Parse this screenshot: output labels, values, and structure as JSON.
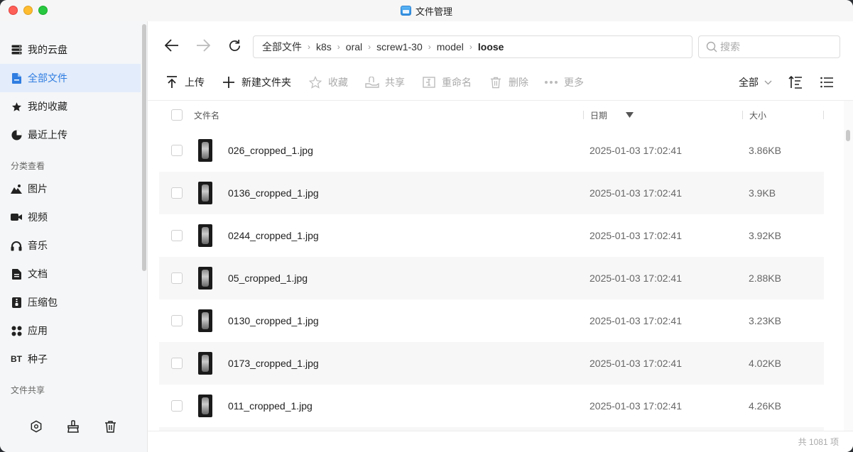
{
  "window": {
    "title": "文件管理"
  },
  "sidebar": {
    "items": [
      {
        "label": "我的云盘",
        "icon": "storage-icon",
        "active": false
      },
      {
        "label": "全部文件",
        "icon": "file-icon",
        "active": true
      },
      {
        "label": "我的收藏",
        "icon": "star-icon",
        "active": false
      },
      {
        "label": "最近上传",
        "icon": "pie-clock-icon",
        "active": false
      }
    ],
    "category_label": "分类查看",
    "categories": [
      {
        "label": "图片",
        "icon": "mountain-icon"
      },
      {
        "label": "视频",
        "icon": "video-icon"
      },
      {
        "label": "音乐",
        "icon": "headphones-icon"
      },
      {
        "label": "文档",
        "icon": "document-icon"
      },
      {
        "label": "压缩包",
        "icon": "archive-icon"
      },
      {
        "label": "应用",
        "icon": "grid-icon"
      },
      {
        "label": "种子",
        "icon": "bt-icon",
        "icon_text": "BT"
      }
    ],
    "share_label": "文件共享",
    "bottom_icons": [
      "settings-hex-icon",
      "clean-brush-icon",
      "trash-icon"
    ]
  },
  "toolbar": {
    "breadcrumb": [
      "全部文件",
      "k8s",
      "oral",
      "screw1-30",
      "model",
      "loose"
    ],
    "search_placeholder": "搜索",
    "actions": [
      {
        "label": "上传",
        "icon": "upload-icon",
        "enabled": true
      },
      {
        "label": "新建文件夹",
        "icon": "plus-icon",
        "enabled": true
      },
      {
        "label": "收藏",
        "icon": "star-outline-icon",
        "enabled": false
      },
      {
        "label": "共享",
        "icon": "share-hand-icon",
        "enabled": false
      },
      {
        "label": "重命名",
        "icon": "rename-icon",
        "enabled": false
      },
      {
        "label": "删除",
        "icon": "trash-outline-icon",
        "enabled": false
      },
      {
        "label": "更多",
        "icon": "more-dots-icon",
        "enabled": false
      }
    ],
    "filter_label": "全部"
  },
  "table": {
    "headers": {
      "name": "文件名",
      "date": "日期",
      "size": "大小"
    },
    "rows": [
      {
        "name": "026_cropped_1.jpg",
        "date": "2025-01-03 17:02:41",
        "size": "3.86KB"
      },
      {
        "name": "0136_cropped_1.jpg",
        "date": "2025-01-03 17:02:41",
        "size": "3.9KB"
      },
      {
        "name": "0244_cropped_1.jpg",
        "date": "2025-01-03 17:02:41",
        "size": "3.92KB"
      },
      {
        "name": "05_cropped_1.jpg",
        "date": "2025-01-03 17:02:41",
        "size": "2.88KB"
      },
      {
        "name": "0130_cropped_1.jpg",
        "date": "2025-01-03 17:02:41",
        "size": "3.23KB"
      },
      {
        "name": "0173_cropped_1.jpg",
        "date": "2025-01-03 17:02:41",
        "size": "4.02KB"
      },
      {
        "name": "011_cropped_1.jpg",
        "date": "2025-01-03 17:02:41",
        "size": "4.26KB"
      }
    ]
  },
  "footer": {
    "count_text": "共 1081 项"
  }
}
